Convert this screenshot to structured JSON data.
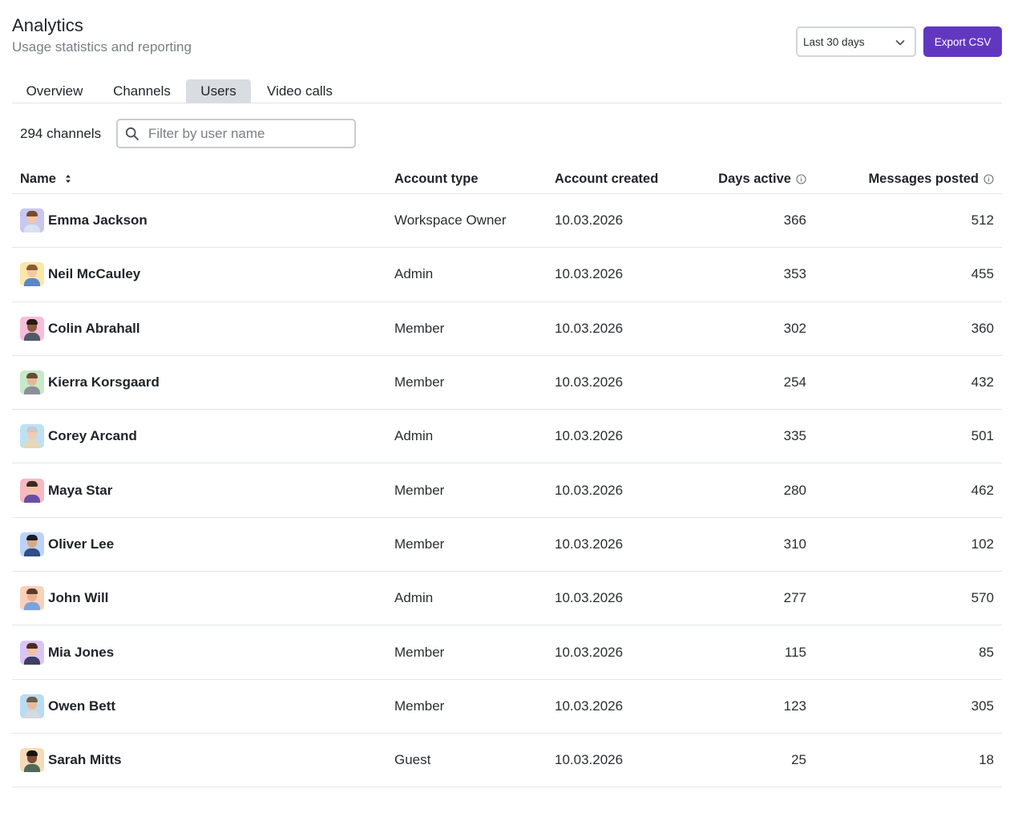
{
  "header": {
    "title": "Analytics",
    "subtitle": "Usage statistics and reporting"
  },
  "controls": {
    "range_value": "Last 30 days",
    "export_label": "Export CSV"
  },
  "tabs": [
    {
      "label": "Overview",
      "active": false
    },
    {
      "label": "Channels",
      "active": false
    },
    {
      "label": "Users",
      "active": true
    },
    {
      "label": "Video calls",
      "active": false
    }
  ],
  "filter": {
    "count_label": "294 channels",
    "placeholder": "Filter by user name",
    "value": ""
  },
  "table": {
    "columns": {
      "name": "Name",
      "account_type": "Account type",
      "account_created": "Account created",
      "days_active": "Days active",
      "messages_posted": "Messages posted"
    },
    "rows": [
      {
        "name": "Emma Jackson",
        "account_type": "Workspace Owner",
        "account_created": "10.03.2026",
        "days_active": "366",
        "messages_posted": "512",
        "avatar_bg": "#c9c6f0",
        "skin": "#f1c6a8",
        "hair": "#7a4a2e",
        "shirt": "#d7e2f2"
      },
      {
        "name": "Neil McCauley",
        "account_type": "Admin",
        "account_created": "10.03.2026",
        "days_active": "353",
        "messages_posted": "455",
        "avatar_bg": "#fbe7a8",
        "skin": "#f2c9a4",
        "hair": "#8b5a35",
        "shirt": "#5b86c7"
      },
      {
        "name": "Colin Abrahall",
        "account_type": "Member",
        "account_created": "10.03.2026",
        "days_active": "302",
        "messages_posted": "360",
        "avatar_bg": "#f7bdd9",
        "skin": "#8a5a3c",
        "hair": "#2a1a12",
        "shirt": "#4e5a6a"
      },
      {
        "name": "Kierra Korsgaard",
        "account_type": "Member",
        "account_created": "10.03.2026",
        "days_active": "254",
        "messages_posted": "432",
        "avatar_bg": "#c7e8c9",
        "skin": "#e7b896",
        "hair": "#6e4a32",
        "shirt": "#8a8f99"
      },
      {
        "name": "Corey Arcand",
        "account_type": "Admin",
        "account_created": "10.03.2026",
        "days_active": "335",
        "messages_posted": "501",
        "avatar_bg": "#bfe1f5",
        "skin": "#f3cbb0",
        "hair": "#c9c9c9",
        "shirt": "#e6d8b6"
      },
      {
        "name": "Maya Star",
        "account_type": "Member",
        "account_created": "10.03.2026",
        "days_active": "280",
        "messages_posted": "462",
        "avatar_bg": "#f7b8c0",
        "skin": "#f0c3a6",
        "hair": "#3a2a24",
        "shirt": "#6a4ea3"
      },
      {
        "name": "Oliver Lee",
        "account_type": "Member",
        "account_created": "10.03.2026",
        "days_active": "310",
        "messages_posted": "102",
        "avatar_bg": "#bcd3f5",
        "skin": "#d9a884",
        "hair": "#1d1d22",
        "shirt": "#2f4f86"
      },
      {
        "name": "John Will",
        "account_type": "Admin",
        "account_created": "10.03.2026",
        "days_active": "277",
        "messages_posted": "570",
        "avatar_bg": "#fbd0b8",
        "skin": "#e8b191",
        "hair": "#5a3b2a",
        "shirt": "#7aa3dd"
      },
      {
        "name": "Mia Jones",
        "account_type": "Member",
        "account_created": "10.03.2026",
        "days_active": "115",
        "messages_posted": "85",
        "avatar_bg": "#d9c5f5",
        "skin": "#f1c1a0",
        "hair": "#4a2c22",
        "shirt": "#3d3f63"
      },
      {
        "name": "Owen Bett",
        "account_type": "Member",
        "account_created": "10.03.2026",
        "days_active": "123",
        "messages_posted": "305",
        "avatar_bg": "#b9dcf2",
        "skin": "#e9bb9a",
        "hair": "#6e5c4c",
        "shirt": "#d6d9de"
      },
      {
        "name": "Sarah Mitts",
        "account_type": "Guest",
        "account_created": "10.03.2026",
        "days_active": "25",
        "messages_posted": "18",
        "avatar_bg": "#f6dbb8",
        "skin": "#7a4f34",
        "hair": "#1a120e",
        "shirt": "#4f6a58"
      }
    ]
  },
  "colors": {
    "accent": "#6237c0",
    "tab_active_bg": "#d9dde2",
    "divider": "#e3e5e8",
    "muted_text": "#7a7f86"
  },
  "icons": {
    "range_chevron": "chevron-down-icon",
    "filter": "search-icon",
    "sort": "sort-icon",
    "info": "info-icon"
  }
}
